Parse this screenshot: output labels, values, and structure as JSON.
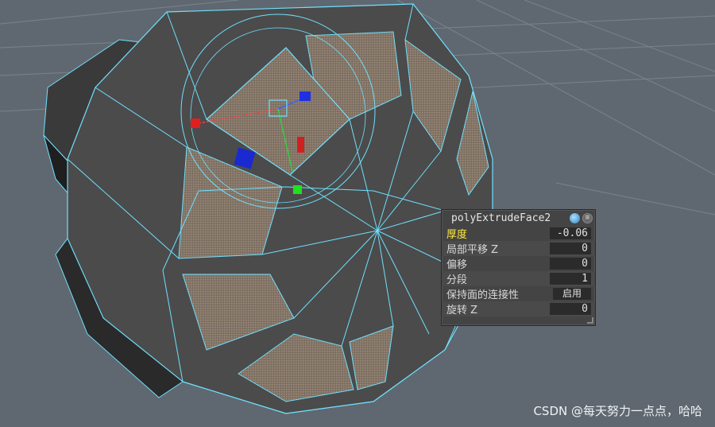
{
  "inbox": {
    "title": "polyExtrudeFace2",
    "rows": [
      {
        "label": "厚度",
        "value": "-0.06"
      },
      {
        "label": "局部平移 Z",
        "value": "0"
      },
      {
        "label": "偏移",
        "value": "0"
      },
      {
        "label": "分段",
        "value": "1"
      },
      {
        "label": "保持面的连接性",
        "value": "启用"
      },
      {
        "label": "旋转 Z",
        "value": "0"
      }
    ]
  },
  "watermark": "CSDN @每天努力一点点，哈哈",
  "colors": {
    "viewport_bg": "#5f6870",
    "wire": "#6fe0ff",
    "mesh": "#454545",
    "face": "#8c7d6e"
  }
}
